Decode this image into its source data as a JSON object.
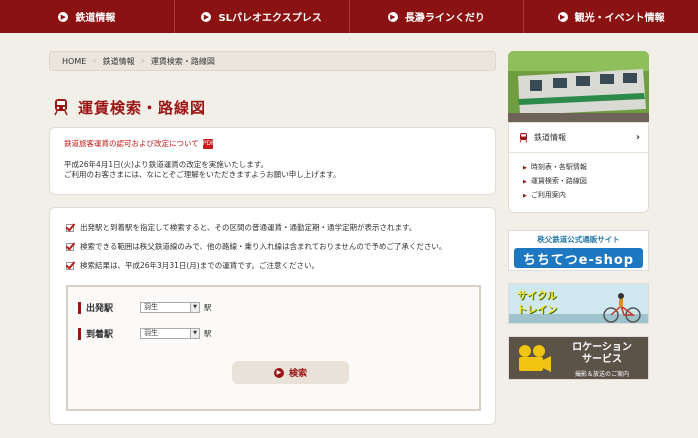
{
  "nav": {
    "items": [
      {
        "label": "鉄道情報"
      },
      {
        "label": "SLパレオエクスプレス"
      },
      {
        "label": "長瀞ラインくだり"
      },
      {
        "label": "観光・イベント情報"
      }
    ]
  },
  "breadcrumb": {
    "home": "HOME",
    "level1": "鉄道情報",
    "level2": "運賃検索・路線図"
  },
  "page": {
    "title": "運賃検索・路線図"
  },
  "notice": {
    "link": "鉄道旅客運賃の認可および改定について",
    "pdf_icon": "PDF",
    "line1": "平成26年4月1日(火)より鉄道運賃の改定を実施いたします。",
    "line2": "ご利用のお客さまには、なにとぞご理解をいただきますようお願い申し上げます。"
  },
  "search": {
    "notes": [
      "出発駅と到着駅を指定して検索すると、その区間の普通運賃・通勤定期・通学定期が表示されます。",
      "検索できる範囲は秩父鉄道線のみで、他の路線・乗り入れ線は含まれておりませんので予めご了承ください。",
      "検索結果は、平成26年3月31日(月)までの運賃です。ご注意ください。"
    ],
    "departure_label": "出発駅",
    "departure_value": "羽生",
    "arrival_label": "到着駅",
    "arrival_value": "羽生",
    "station_suffix": "駅",
    "button_label": "検索"
  },
  "sidebar": {
    "head": "鉄道情報",
    "links": [
      "時刻表・各駅情報",
      "運賃検索・路線図",
      "ご利用案内"
    ]
  },
  "banners": {
    "shop_title": "秩父鉄道公式通販サイト",
    "shop_name": "ちちてつe-shop",
    "cycle_line1": "サイクル",
    "cycle_line2": "トレイン",
    "loc_line1": "ロケーション",
    "loc_line2": "サービス",
    "loc_sub": "撮影＆放送のご案内"
  },
  "colors": {
    "brand": "#8b1212",
    "accent": "#c01a1a"
  }
}
